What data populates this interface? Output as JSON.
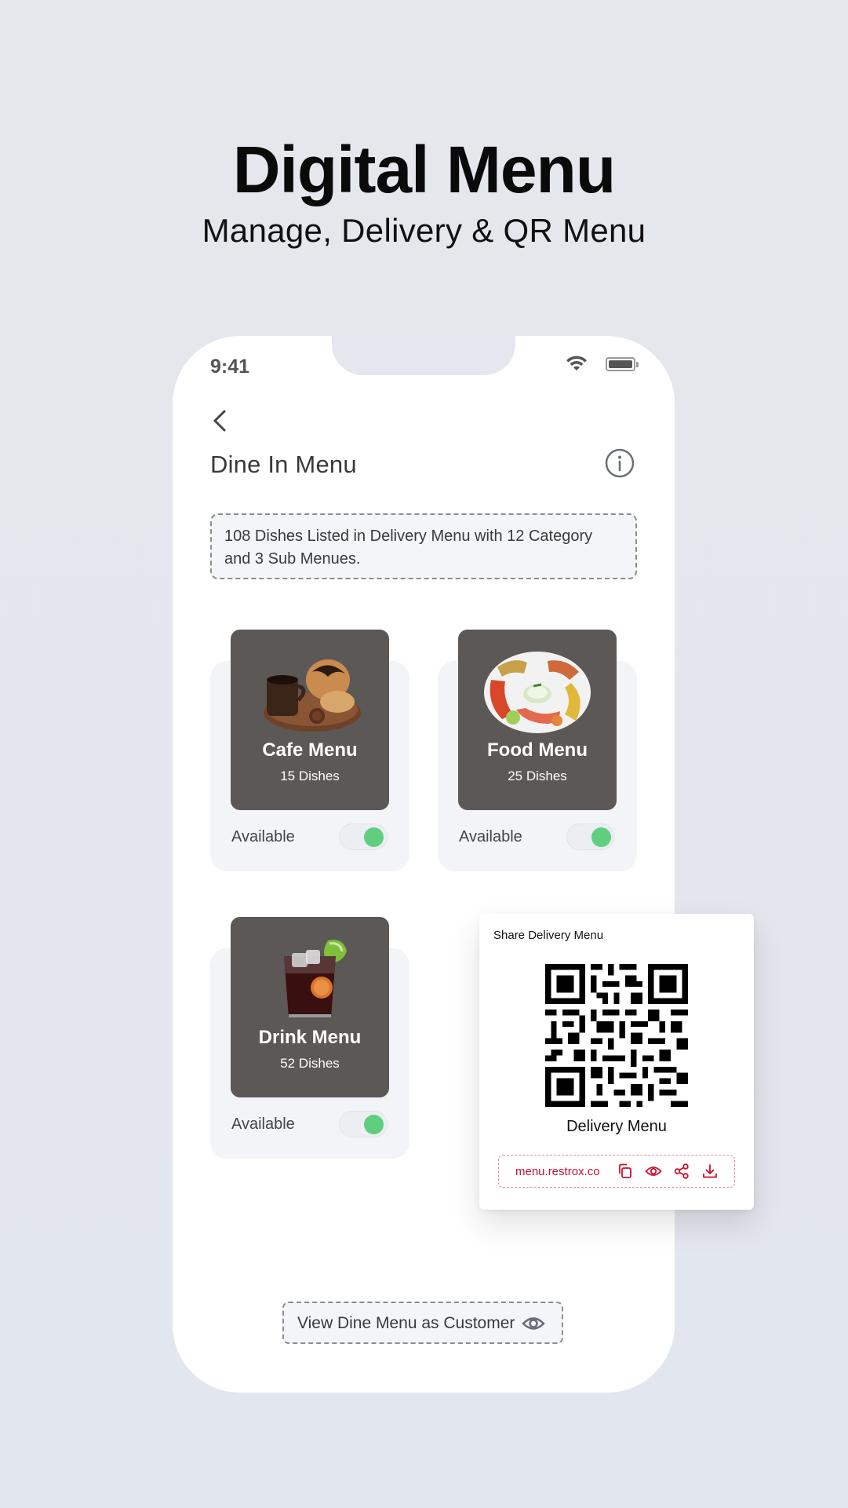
{
  "hero": {
    "title": "Digital Menu",
    "subtitle": "Manage, Delivery & QR Menu"
  },
  "status_bar": {
    "time": "9:41",
    "icons": [
      "wifi-icon",
      "battery-icon"
    ]
  },
  "header": {
    "back_icon": "chevron-left-icon",
    "title": "Dine In Menu",
    "info_icon": "info-icon"
  },
  "summary": "108 Dishes Listed in Delivery Menu with 12 Category and 3 Sub Menues.",
  "menus": [
    {
      "name": "Cafe Menu",
      "count": "15 Dishes",
      "status_label": "Available",
      "available": true,
      "image": "coffee-pastries"
    },
    {
      "name": "Food Menu",
      "count": "25 Dishes",
      "status_label": "Available",
      "available": true,
      "image": "food-platter"
    },
    {
      "name": "Drink Menu",
      "count": "52 Dishes",
      "status_label": "Available",
      "available": true,
      "image": "cola-drink"
    }
  ],
  "share": {
    "title": "Share Delivery Menu",
    "menu_name": "Delivery Menu",
    "link": "menu.restrox.co",
    "actions": [
      "copy-icon",
      "eye-icon",
      "share-icon",
      "download-icon"
    ]
  },
  "footer": {
    "view_button_label": "View Dine Menu as Customer",
    "view_icon": "eye-icon"
  },
  "colors": {
    "background": "#e4e7ed",
    "tile": "#5c5856",
    "toggle_on": "#5fcf7f",
    "link": "#c8102e",
    "text": "#3a3a3a"
  }
}
